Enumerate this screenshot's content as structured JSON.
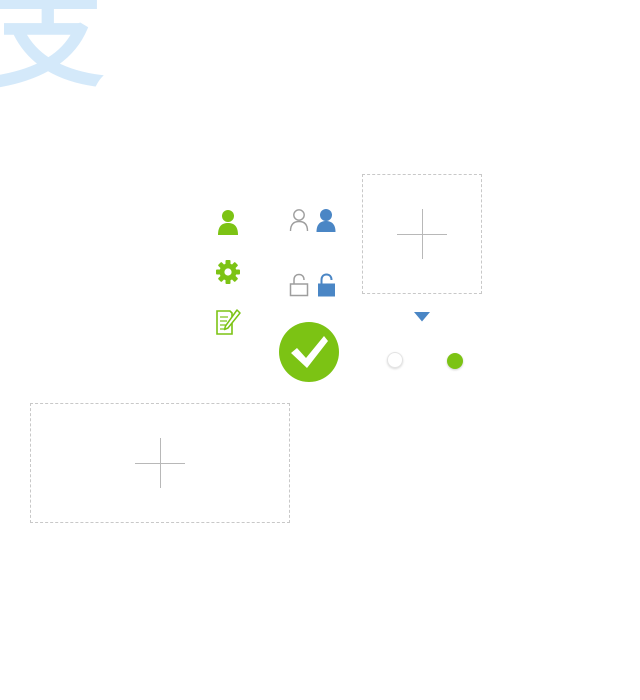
{
  "logo": {
    "text": "支",
    "color": "#d4e9fa"
  },
  "colors": {
    "accent_green": "#7cc314",
    "accent_blue": "#4a86c5",
    "muted_gray": "#9e9e9e",
    "dashed_border": "#c8c8c8"
  },
  "icons": {
    "user_green": "user-icon",
    "settings": "gear-icon",
    "edit": "edit-icon",
    "user_outline": "user-outline-icon",
    "user_blue": "user-icon",
    "lock_closed": "lock-icon",
    "lock_open": "unlock-icon",
    "confirm": "check-icon",
    "dropdown": "caret-down-icon"
  },
  "upload_boxes": [
    {
      "icon": "plus-icon"
    },
    {
      "icon": "plus-icon"
    }
  ],
  "radios": [
    {
      "state": "unselected"
    },
    {
      "state": "selected"
    }
  ]
}
